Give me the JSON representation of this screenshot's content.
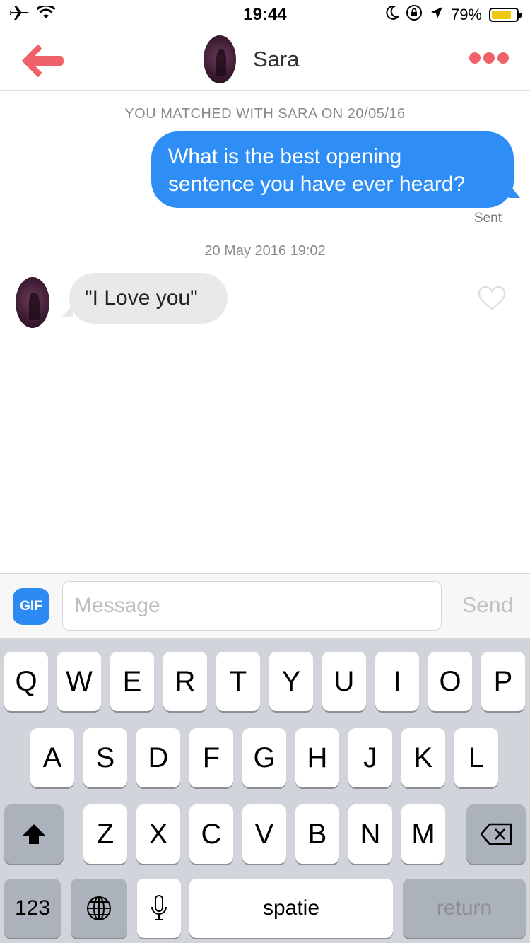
{
  "status_bar": {
    "time": "19:44",
    "battery_percent": "79%",
    "battery_level": 0.79,
    "battery_color": "#f2c70f",
    "icons": [
      "airplane-icon",
      "wifi-icon",
      "moon-icon",
      "rotation-lock-icon",
      "location-icon",
      "battery-icon"
    ]
  },
  "header": {
    "name": "Sara",
    "back_icon": "back-arrow-icon",
    "more_icon": "more-dots-icon",
    "accent_color": "#f0626a"
  },
  "chat": {
    "match_note": "YOU MATCHED WITH SARA ON 20/05/16",
    "sent_message": {
      "line1": "What is the best opening",
      "line2": "sentence you have ever heard?"
    },
    "sent_label": "Sent",
    "timestamp": "20 May 2016 19:02",
    "received_message": "\"I Love you\"",
    "bubble_out_color": "#2f8ef5",
    "bubble_in_color": "#e9e9e9"
  },
  "compose": {
    "gif_label": "GIF",
    "placeholder": "Message",
    "send_label": "Send"
  },
  "keyboard": {
    "row1": [
      "Q",
      "W",
      "E",
      "R",
      "T",
      "Y",
      "U",
      "I",
      "O",
      "P"
    ],
    "row2": [
      "A",
      "S",
      "D",
      "F",
      "G",
      "H",
      "J",
      "K",
      "L"
    ],
    "row3": [
      "Z",
      "X",
      "C",
      "V",
      "B",
      "N",
      "M"
    ],
    "numbers_label": "123",
    "space_label": "spatie",
    "return_label": "return"
  }
}
